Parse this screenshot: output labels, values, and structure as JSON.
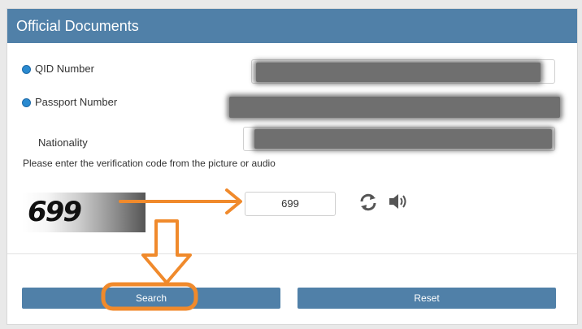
{
  "panel": {
    "title": "Official Documents"
  },
  "form": {
    "qid_label": "QID Number",
    "passport_label": "Passport Number",
    "nationality_label": "Nationality",
    "verification_hint": "Please enter the verification code from the picture or audio",
    "captcha_image_text": "699",
    "verification_value": "699"
  },
  "icons": {
    "refresh": "refresh-icon",
    "audio": "speaker-icon"
  },
  "buttons": {
    "search_label": "Search",
    "reset_label": "Reset"
  },
  "colors": {
    "header": "#5080a8",
    "button": "#5080a8",
    "radio": "#2a8ad0",
    "annotation": "#f08a2c"
  }
}
